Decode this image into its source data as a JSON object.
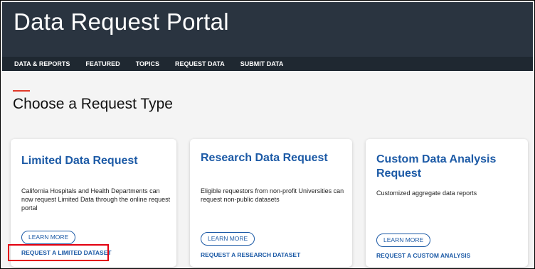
{
  "header": {
    "title": "Data Request Portal"
  },
  "nav": {
    "items": [
      "DATA & REPORTS",
      "FEATURED",
      "TOPICS",
      "REQUEST DATA",
      "SUBMIT DATA"
    ]
  },
  "main": {
    "section_title": "Choose a Request Type",
    "cards": [
      {
        "title": "Limited Data Request",
        "description": "California Hospitals and Health Departments can now request Limited Data through the online request portal",
        "learn_more": "LEARN MORE",
        "request_link": "REQUEST A LIMITED DATASET"
      },
      {
        "title": "Research Data Request",
        "description": "Eligible requestors from non-profit Universities can request non-public datasets",
        "learn_more": "LEARN MORE",
        "request_link": "REQUEST A RESEARCH DATASET"
      },
      {
        "title": "Custom Data Analysis Request",
        "description": "Customized aggregate data reports",
        "learn_more": "LEARN MORE",
        "request_link": "REQUEST A CUSTOM ANALYSIS"
      }
    ]
  },
  "colors": {
    "header_bg": "#2a3440",
    "nav_bg": "#1f2831",
    "accent": "#e03a2a",
    "link": "#1c5aa6",
    "highlight": "#e3000f"
  }
}
